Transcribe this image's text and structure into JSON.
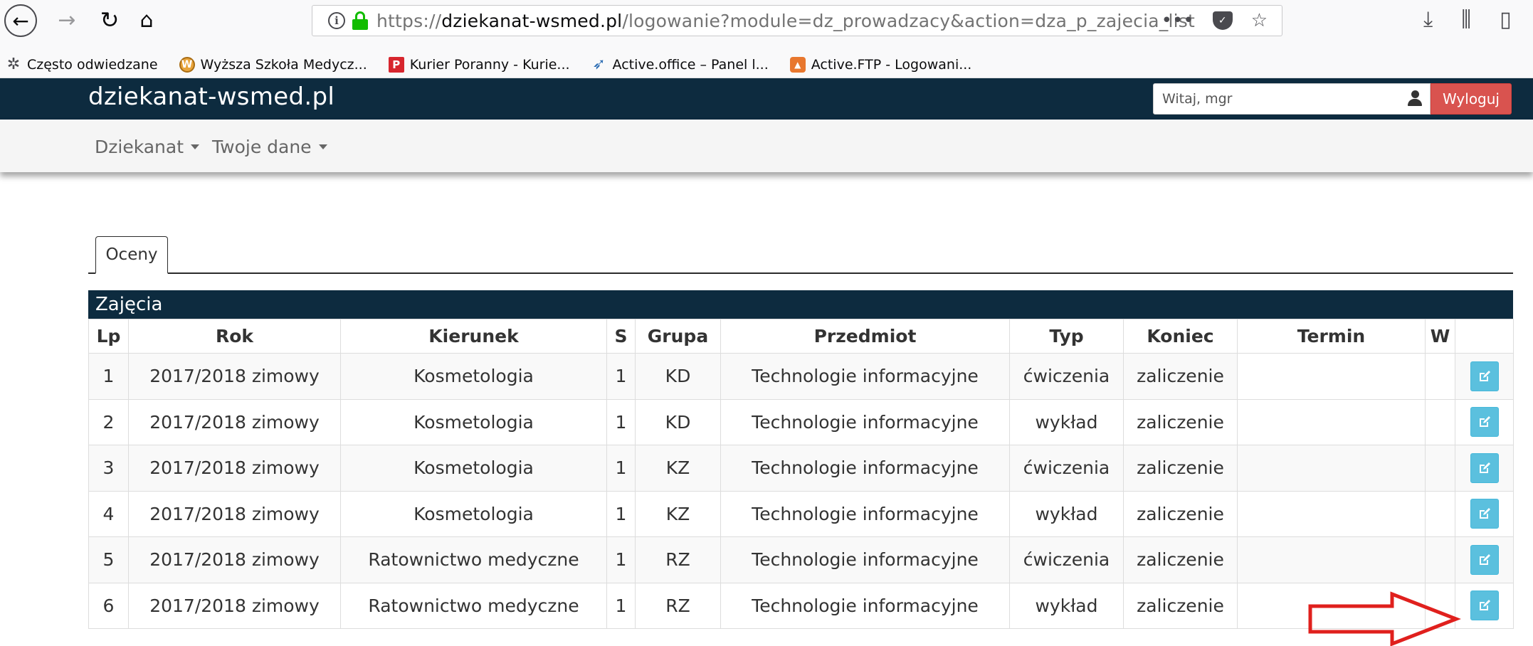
{
  "browser": {
    "url_prefix": "https://",
    "url_host": "dziekanat-wsmed.pl",
    "url_path": "/logowanie?module=dz_prowadzacy&action=dza_p_zajecia_list",
    "url_more": "•••",
    "bookmarks": [
      {
        "icon": "gear-icon",
        "label": "Często odwiedzane"
      },
      {
        "icon": "wsm-logo-icon",
        "label": "Wyższa Szkoła Medycz..."
      },
      {
        "icon": "kurier-icon",
        "label": "Kurier Poranny - Kurie..."
      },
      {
        "icon": "active-office-icon",
        "label": "Active.office – Panel l..."
      },
      {
        "icon": "active-ftp-icon",
        "label": "Active.FTP - Logowani..."
      }
    ]
  },
  "header": {
    "brand": "dziekanat-wsmed.pl",
    "welcome_label": "Witaj, mgr",
    "logout_label": "Wyloguj"
  },
  "menu": {
    "items": [
      {
        "label": "Dziekanat"
      },
      {
        "label": "Twoje dane"
      }
    ]
  },
  "tabs": [
    {
      "label": "Oceny",
      "active": true
    }
  ],
  "panel": {
    "title": "Zajęcia"
  },
  "table": {
    "columns": [
      "Lp",
      "Rok",
      "Kierunek",
      "S",
      "Grupa",
      "Przedmiot",
      "Typ",
      "Koniec",
      "Termin",
      "W",
      ""
    ],
    "rows": [
      {
        "lp": "1",
        "rok": "2017/2018 zimowy",
        "kierunek": "Kosmetologia",
        "s": "1",
        "grupa": "KD",
        "przedmiot": "Technologie informacyjne",
        "typ": "ćwiczenia",
        "koniec": "zaliczenie",
        "termin": "",
        "w": ""
      },
      {
        "lp": "2",
        "rok": "2017/2018 zimowy",
        "kierunek": "Kosmetologia",
        "s": "1",
        "grupa": "KD",
        "przedmiot": "Technologie informacyjne",
        "typ": "wykład",
        "koniec": "zaliczenie",
        "termin": "",
        "w": ""
      },
      {
        "lp": "3",
        "rok": "2017/2018 zimowy",
        "kierunek": "Kosmetologia",
        "s": "1",
        "grupa": "KZ",
        "przedmiot": "Technologie informacyjne",
        "typ": "ćwiczenia",
        "koniec": "zaliczenie",
        "termin": "",
        "w": ""
      },
      {
        "lp": "4",
        "rok": "2017/2018 zimowy",
        "kierunek": "Kosmetologia",
        "s": "1",
        "grupa": "KZ",
        "przedmiot": "Technologie informacyjne",
        "typ": "wykład",
        "koniec": "zaliczenie",
        "termin": "",
        "w": ""
      },
      {
        "lp": "5",
        "rok": "2017/2018 zimowy",
        "kierunek": "Ratownictwo medyczne",
        "s": "1",
        "grupa": "RZ",
        "przedmiot": "Technologie informacyjne",
        "typ": "ćwiczenia",
        "koniec": "zaliczenie",
        "termin": "",
        "w": ""
      },
      {
        "lp": "6",
        "rok": "2017/2018 zimowy",
        "kierunek": "Ratownictwo medyczne",
        "s": "1",
        "grupa": "RZ",
        "przedmiot": "Technologie informacyjne",
        "typ": "wykład",
        "koniec": "zaliczenie",
        "termin": "",
        "w": ""
      }
    ]
  },
  "colors": {
    "navbar": "#0d2b3f",
    "logout": "#d9534f",
    "edit_button": "#5bc0de",
    "annotation_arrow": "#e0201d"
  }
}
